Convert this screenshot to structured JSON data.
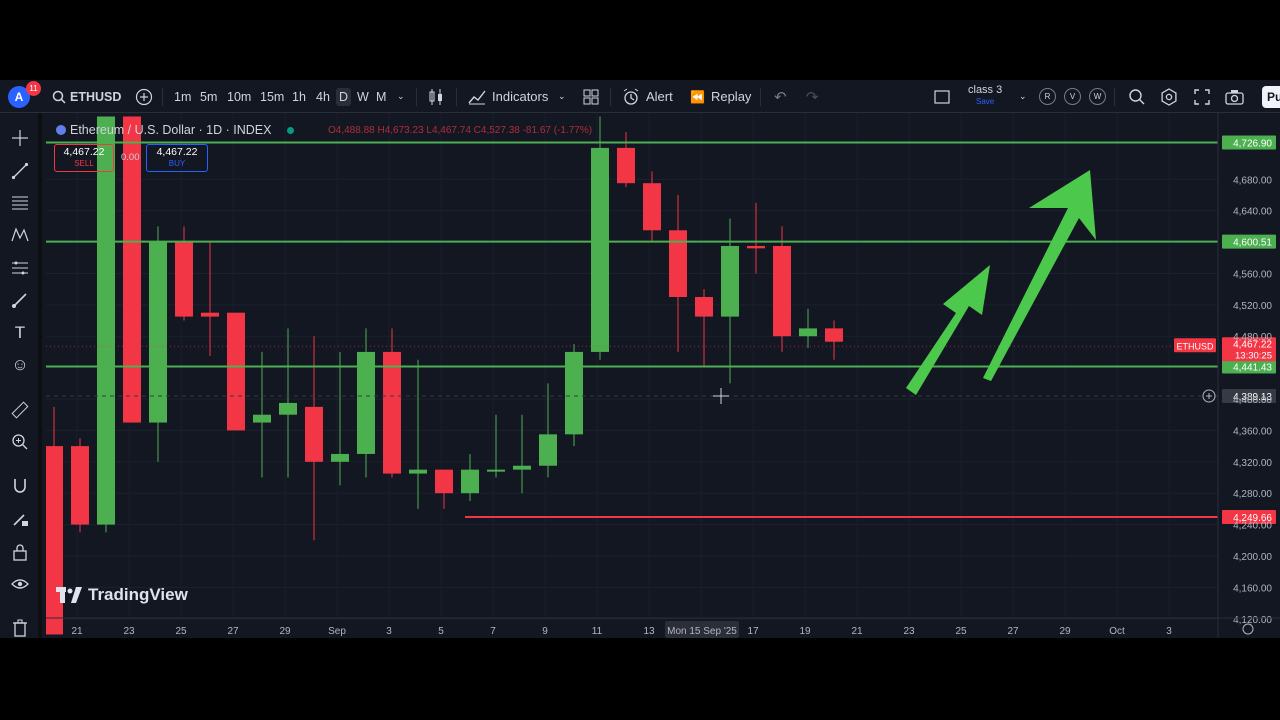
{
  "topbar": {
    "avatar_letter": "A",
    "notification_count": "11",
    "symbol": "ETHUSD",
    "timeframes": [
      "1m",
      "5m",
      "10m",
      "15m",
      "1h",
      "4h",
      "D",
      "W",
      "M"
    ],
    "active_timeframe": "D",
    "indicators_label": "Indicators",
    "alert_label": "Alert",
    "replay_label": "Replay",
    "layout_name": "class 3",
    "layout_save": "Save",
    "circle_letters": [
      "R",
      "V",
      "W"
    ],
    "publish_label": "Pu"
  },
  "legend": {
    "title": "Ethereum / U.S. Dollar · 1D · INDEX",
    "ohlc": "O4,488.88 H4,673.23 L4,467.74 C4,527.38 -81.67 (-1.77%)"
  },
  "trade": {
    "sell_price": "4,467.22",
    "sell_label": "SELL",
    "spread": "0.00",
    "buy_price": "4,467.22",
    "buy_label": "BUY"
  },
  "branding": {
    "logo_text": "TradingView"
  },
  "chart_data": {
    "type": "candlestick",
    "symbol": "ETHUSD",
    "interval": "1D",
    "ylim": [
      4100,
      4750
    ],
    "y_ticks": [
      {
        "value": 4680,
        "label": "4,680.00"
      },
      {
        "value": 4640,
        "label": "4,640.00"
      },
      {
        "value": 4560,
        "label": "4,560.00"
      },
      {
        "value": 4520,
        "label": "4,520.00"
      },
      {
        "value": 4480,
        "label": "4,480.00"
      },
      {
        "value": 4400,
        "label": "4,400.00"
      },
      {
        "value": 4360,
        "label": "4,360.00"
      },
      {
        "value": 4320,
        "label": "4,320.00"
      },
      {
        "value": 4280,
        "label": "4,280.00"
      },
      {
        "value": 4240,
        "label": "4,240.00"
      },
      {
        "value": 4200,
        "label": "4,200.00"
      },
      {
        "value": 4160,
        "label": "4,160.00"
      },
      {
        "value": 4120,
        "label": "4,120.00"
      }
    ],
    "x_ticks": [
      "21",
      "23",
      "25",
      "27",
      "29",
      "Sep",
      "3",
      "5",
      "7",
      "9",
      "11",
      "13",
      "Mon 15 Sep '25",
      "17",
      "19",
      "21",
      "23",
      "25",
      "27",
      "29",
      "Oct",
      "3"
    ],
    "candles": [
      {
        "o": 4340,
        "h": 4390,
        "l": 4100,
        "c": 4100
      },
      {
        "o": 4340,
        "h": 4350,
        "l": 4230,
        "c": 4240
      },
      {
        "o": 4240,
        "h": 4760,
        "l": 4230,
        "c": 4760
      },
      {
        "o": 4760,
        "h": 4760,
        "l": 4370,
        "c": 4370
      },
      {
        "o": 4370,
        "h": 4620,
        "l": 4320,
        "c": 4600
      },
      {
        "o": 4600,
        "h": 4620,
        "l": 4500,
        "c": 4505
      },
      {
        "o": 4510,
        "h": 4600,
        "l": 4455,
        "c": 4505
      },
      {
        "o": 4510,
        "h": 4510,
        "l": 4360,
        "c": 4360
      },
      {
        "o": 4370,
        "h": 4460,
        "l": 4300,
        "c": 4380
      },
      {
        "o": 4380,
        "h": 4490,
        "l": 4300,
        "c": 4395
      },
      {
        "o": 4390,
        "h": 4480,
        "l": 4220,
        "c": 4320
      },
      {
        "o": 4320,
        "h": 4460,
        "l": 4290,
        "c": 4330
      },
      {
        "o": 4330,
        "h": 4490,
        "l": 4300,
        "c": 4460
      },
      {
        "o": 4460,
        "h": 4490,
        "l": 4300,
        "c": 4305
      },
      {
        "o": 4305,
        "h": 4450,
        "l": 4260,
        "c": 4310
      },
      {
        "o": 4310,
        "h": 4310,
        "l": 4260,
        "c": 4280
      },
      {
        "o": 4280,
        "h": 4330,
        "l": 4270,
        "c": 4310
      },
      {
        "o": 4310,
        "h": 4380,
        "l": 4300,
        "c": 4310
      },
      {
        "o": 4310,
        "h": 4380,
        "l": 4280,
        "c": 4315
      },
      {
        "o": 4315,
        "h": 4420,
        "l": 4300,
        "c": 4355
      },
      {
        "o": 4355,
        "h": 4470,
        "l": 4340,
        "c": 4460
      },
      {
        "o": 4460,
        "h": 4760,
        "l": 4450,
        "c": 4720
      },
      {
        "o": 4720,
        "h": 4740,
        "l": 4670,
        "c": 4675
      },
      {
        "o": 4675,
        "h": 4690,
        "l": 4600,
        "c": 4615
      },
      {
        "o": 4615,
        "h": 4660,
        "l": 4460,
        "c": 4530
      },
      {
        "o": 4530,
        "h": 4540,
        "l": 4440,
        "c": 4505
      },
      {
        "o": 4505,
        "h": 4630,
        "l": 4420,
        "c": 4595
      },
      {
        "o": 4595,
        "h": 4650,
        "l": 4560,
        "c": 4592
      },
      {
        "o": 4595,
        "h": 4620,
        "l": 4460,
        "c": 4480
      },
      {
        "o": 4480,
        "h": 4515,
        "l": 4465,
        "c": 4490
      },
      {
        "o": 4490,
        "h": 4500,
        "l": 4450,
        "c": 4473
      }
    ],
    "horizontal_lines": [
      {
        "value": 4726.9,
        "label": "4,726.90",
        "color": "#4caf50"
      },
      {
        "value": 4600.51,
        "label": "4,600.51",
        "color": "#4caf50"
      },
      {
        "value": 4441.43,
        "label": "4,441.43",
        "color": "#4caf50"
      },
      {
        "value": 4249.66,
        "label": "4,249.66",
        "color": "#f23645"
      }
    ],
    "current_price": {
      "symbol": "ETHUSD",
      "value": 4467.22,
      "label": "4,467.22",
      "countdown": "13:30:25"
    },
    "crosshair": {
      "value": 4389.13,
      "label": "4,389.13"
    },
    "colors": {
      "up": "#4caf50",
      "down": "#f23645",
      "background": "#131722",
      "arrow": "#4cc94c"
    }
  }
}
